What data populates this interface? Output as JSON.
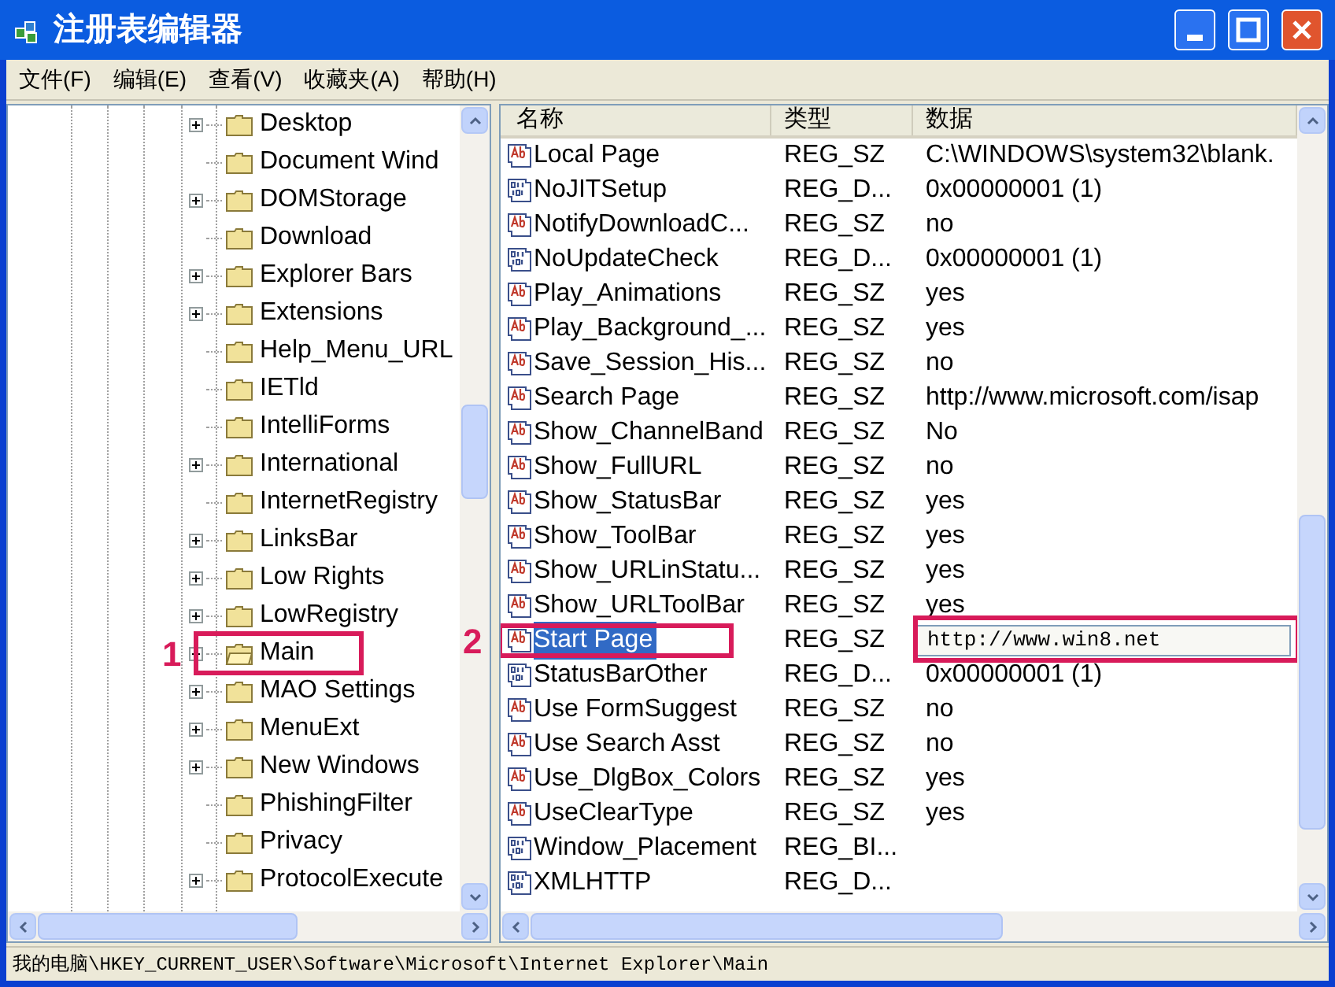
{
  "window": {
    "title": "注册表编辑器"
  },
  "menu": [
    "文件(F)",
    "编辑(E)",
    "查看(V)",
    "收藏夹(A)",
    "帮助(H)"
  ],
  "tree": {
    "items": [
      {
        "label": "Desktop",
        "expandable": true,
        "selected": false
      },
      {
        "label": "Document Wind",
        "expandable": false,
        "selected": false
      },
      {
        "label": "DOMStorage",
        "expandable": true,
        "selected": false
      },
      {
        "label": "Download",
        "expandable": false,
        "selected": false
      },
      {
        "label": "Explorer Bars",
        "expandable": true,
        "selected": false
      },
      {
        "label": "Extensions",
        "expandable": true,
        "selected": false
      },
      {
        "label": "Help_Menu_URL",
        "expandable": false,
        "selected": false
      },
      {
        "label": "IETld",
        "expandable": false,
        "selected": false
      },
      {
        "label": "IntelliForms",
        "expandable": false,
        "selected": false
      },
      {
        "label": "International",
        "expandable": true,
        "selected": false
      },
      {
        "label": "InternetRegistry",
        "expandable": false,
        "selected": false
      },
      {
        "label": "LinksBar",
        "expandable": true,
        "selected": false
      },
      {
        "label": "Low Rights",
        "expandable": true,
        "selected": false
      },
      {
        "label": "LowRegistry",
        "expandable": true,
        "selected": false
      },
      {
        "label": "Main",
        "expandable": true,
        "selected": true,
        "callout": "1"
      },
      {
        "label": "MAO Settings",
        "expandable": true,
        "selected": false
      },
      {
        "label": "MenuExt",
        "expandable": true,
        "selected": false
      },
      {
        "label": "New Windows",
        "expandable": true,
        "selected": false
      },
      {
        "label": "PhishingFilter",
        "expandable": false,
        "selected": false
      },
      {
        "label": "Privacy",
        "expandable": false,
        "selected": false
      },
      {
        "label": "ProtocolExecute",
        "expandable": true,
        "selected": false
      }
    ]
  },
  "values": {
    "columns": [
      "名称",
      "类型",
      "数据"
    ],
    "rows": [
      {
        "kind": "string",
        "name": "Local Page",
        "type": "REG_SZ",
        "data": "C:\\WINDOWS\\system32\\blank.",
        "selected": false,
        "editing": false
      },
      {
        "kind": "binary",
        "name": "NoJITSetup",
        "type": "REG_D...",
        "data": "0x00000001 (1)",
        "selected": false,
        "editing": false
      },
      {
        "kind": "string",
        "name": "NotifyDownloadC...",
        "type": "REG_SZ",
        "data": "no",
        "selected": false,
        "editing": false
      },
      {
        "kind": "binary",
        "name": "NoUpdateCheck",
        "type": "REG_D...",
        "data": "0x00000001 (1)",
        "selected": false,
        "editing": false
      },
      {
        "kind": "string",
        "name": "Play_Animations",
        "type": "REG_SZ",
        "data": "yes",
        "selected": false,
        "editing": false
      },
      {
        "kind": "string",
        "name": "Play_Background_...",
        "type": "REG_SZ",
        "data": "yes",
        "selected": false,
        "editing": false
      },
      {
        "kind": "string",
        "name": "Save_Session_His...",
        "type": "REG_SZ",
        "data": "no",
        "selected": false,
        "editing": false
      },
      {
        "kind": "string",
        "name": "Search Page",
        "type": "REG_SZ",
        "data": "http://www.microsoft.com/isap",
        "selected": false,
        "editing": false
      },
      {
        "kind": "string",
        "name": "Show_ChannelBand",
        "type": "REG_SZ",
        "data": "No",
        "selected": false,
        "editing": false
      },
      {
        "kind": "string",
        "name": "Show_FullURL",
        "type": "REG_SZ",
        "data": "no",
        "selected": false,
        "editing": false
      },
      {
        "kind": "string",
        "name": "Show_StatusBar",
        "type": "REG_SZ",
        "data": "yes",
        "selected": false,
        "editing": false
      },
      {
        "kind": "string",
        "name": "Show_ToolBar",
        "type": "REG_SZ",
        "data": "yes",
        "selected": false,
        "editing": false
      },
      {
        "kind": "string",
        "name": "Show_URLinStatu...",
        "type": "REG_SZ",
        "data": "yes",
        "selected": false,
        "editing": false
      },
      {
        "kind": "string",
        "name": "Show_URLToolBar",
        "type": "REG_SZ",
        "data": "yes",
        "selected": false,
        "editing": false
      },
      {
        "kind": "string",
        "name": "Start Page",
        "type": "REG_SZ",
        "data": "http://www.win8.net",
        "selected": true,
        "editing": true,
        "callout": "2"
      },
      {
        "kind": "binary",
        "name": "StatusBarOther",
        "type": "REG_D...",
        "data": "0x00000001 (1)",
        "selected": false,
        "editing": false
      },
      {
        "kind": "string",
        "name": "Use FormSuggest",
        "type": "REG_SZ",
        "data": "no",
        "selected": false,
        "editing": false
      },
      {
        "kind": "string",
        "name": "Use Search Asst",
        "type": "REG_SZ",
        "data": "no",
        "selected": false,
        "editing": false
      },
      {
        "kind": "string",
        "name": "Use_DlgBox_Colors",
        "type": "REG_SZ",
        "data": "yes",
        "selected": false,
        "editing": false
      },
      {
        "kind": "string",
        "name": "UseClearType",
        "type": "REG_SZ",
        "data": "yes",
        "selected": false,
        "editing": false
      },
      {
        "kind": "binary",
        "name": "Window_Placement",
        "type": "REG_BI...",
        "selected": false
      },
      {
        "kind": "binary",
        "name": "XMLHTTP",
        "type": "REG_D...",
        "selected": false
      }
    ]
  },
  "status_bar": "我的电脑\\HKEY_CURRENT_USER\\Software\\Microsoft\\Internet Explorer\\Main"
}
